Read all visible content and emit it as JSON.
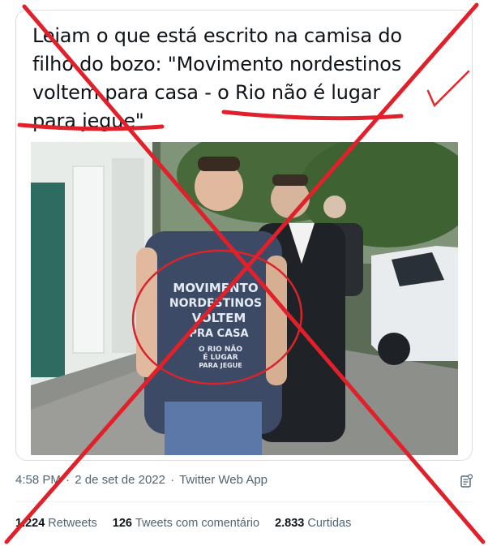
{
  "tweet": {
    "text_lines": [
      "Leiam o que está escrito na camisa do",
      "filho do bozo: \"Movimento nordestinos",
      "voltem para casa - o Rio não é lugar",
      "para jegue\""
    ],
    "photo": {
      "shirt_text": [
        "MOVIMENTO",
        "NORDESTINOS",
        "VOLTEM",
        "PRA CASA",
        "O RIO NÃO",
        "É LUGAR",
        "PARA JEGUE"
      ]
    },
    "time": "4:58 PM",
    "separator": "·",
    "date": "2 de set de 2022",
    "source": "Twitter Web App",
    "icons": {
      "copy": "copy-doc-icon"
    }
  },
  "stats": [
    {
      "value": "1.224",
      "label": "Retweets"
    },
    {
      "value": "126",
      "label": "Tweets com comentário"
    },
    {
      "value": "2.833",
      "label": "Curtidas"
    }
  ],
  "overlay": {
    "cross_color": "#e0202a",
    "circle_color": "#d9242c",
    "check_color": "#e02a2a"
  }
}
